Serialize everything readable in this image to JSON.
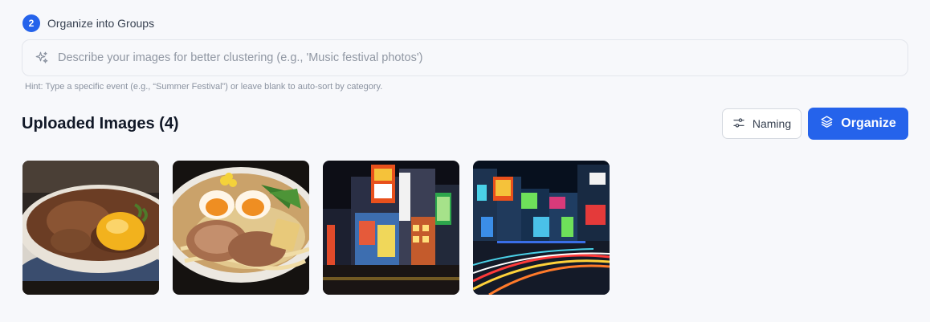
{
  "step": {
    "number": "2",
    "title": "Organize into Groups"
  },
  "search": {
    "placeholder": "Describe your images for better clustering (e.g., 'Music festival photos')",
    "value": "",
    "icon": "sparkle-icon"
  },
  "hint": "Hint: Type a specific event (e.g., “Summer Festival”) or leave blank to auto-sort by category.",
  "uploaded": {
    "title": "Uploaded Images (4)"
  },
  "actions": {
    "naming_label": "Naming",
    "naming_icon": "sliders-icon",
    "organize_label": "Organize",
    "organize_icon": "layers-icon"
  },
  "colors": {
    "accent": "#2563eb",
    "background": "#f7f8fb"
  },
  "images": [
    {
      "subject": "beef rice bowl with raw egg yolk"
    },
    {
      "subject": "ramen bowl with chashu and soft-boiled eggs"
    },
    {
      "subject": "Tokyo night street with neon signs"
    },
    {
      "subject": "Tokyo night intersection with light trails"
    }
  ]
}
